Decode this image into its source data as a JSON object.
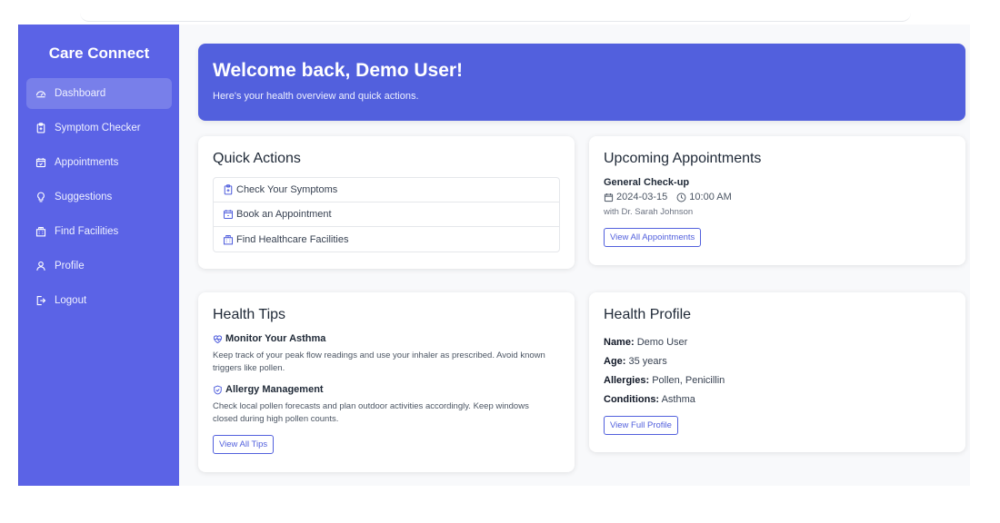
{
  "sidebar": {
    "brand": "Care Connect",
    "items": [
      {
        "label": "Dashboard",
        "icon": "dashboard-icon",
        "active": true
      },
      {
        "label": "Symptom Checker",
        "icon": "clipboard-icon"
      },
      {
        "label": "Appointments",
        "icon": "calendar-icon"
      },
      {
        "label": "Suggestions",
        "icon": "lightbulb-icon"
      },
      {
        "label": "Find Facilities",
        "icon": "hospital-icon"
      },
      {
        "label": "Profile",
        "icon": "user-icon"
      },
      {
        "label": "Logout",
        "icon": "logout-icon"
      }
    ]
  },
  "hero": {
    "title": "Welcome back, Demo User!",
    "subtitle": "Here's your health overview and quick actions."
  },
  "quick_actions": {
    "title": "Quick Actions",
    "items": [
      {
        "label": "Check Your Symptoms",
        "icon": "clipboard-icon"
      },
      {
        "label": "Book an Appointment",
        "icon": "calendar-icon"
      },
      {
        "label": "Find Healthcare Facilities",
        "icon": "hospital-icon"
      }
    ]
  },
  "appointments": {
    "title": "Upcoming Appointments",
    "item_title": "General Check-up",
    "date": "2024-03-15",
    "time": "10:00 AM",
    "doctor": "with Dr. Sarah Johnson",
    "button": "View All Appointments"
  },
  "tips": {
    "title": "Health Tips",
    "items": [
      {
        "title": "Monitor Your Asthma",
        "icon": "heart-pulse-icon",
        "body": "Keep track of your peak flow readings and use your inhaler as prescribed. Avoid known triggers like pollen."
      },
      {
        "title": "Allergy Management",
        "icon": "shield-icon",
        "body": "Check local pollen forecasts and plan outdoor activities accordingly. Keep windows closed during high pollen counts."
      }
    ],
    "button": "View All Tips"
  },
  "profile": {
    "title": "Health Profile",
    "name_label": "Name:",
    "name": "Demo User",
    "age_label": "Age:",
    "age": "35 years",
    "allergies_label": "Allergies:",
    "allergies": "Pollen, Penicillin",
    "conditions_label": "Conditions:",
    "conditions": "Asthma",
    "button": "View Full Profile"
  },
  "colors": {
    "primary": "#5260dd",
    "sidebar": "#5b63e6"
  }
}
